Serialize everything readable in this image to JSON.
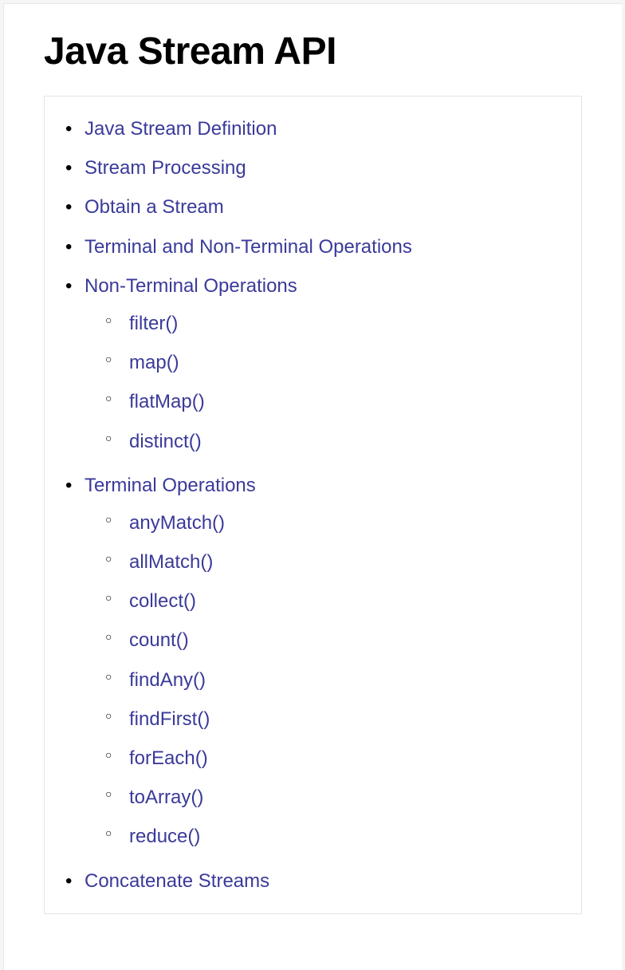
{
  "title": "Java Stream API",
  "toc": [
    {
      "label": "Java Stream Definition"
    },
    {
      "label": "Stream Processing"
    },
    {
      "label": "Obtain a Stream"
    },
    {
      "label": "Terminal and Non-Terminal Operations"
    },
    {
      "label": "Non-Terminal Operations",
      "children": [
        {
          "label": "filter()"
        },
        {
          "label": "map()"
        },
        {
          "label": "flatMap()"
        },
        {
          "label": "distinct()"
        }
      ]
    },
    {
      "label": "Terminal Operations",
      "children": [
        {
          "label": "anyMatch()"
        },
        {
          "label": "allMatch()"
        },
        {
          "label": "collect()"
        },
        {
          "label": "count()"
        },
        {
          "label": "findAny()"
        },
        {
          "label": "findFirst()"
        },
        {
          "label": "forEach()"
        },
        {
          "label": "toArray()"
        },
        {
          "label": "reduce()"
        }
      ]
    },
    {
      "label": "Concatenate Streams"
    }
  ]
}
